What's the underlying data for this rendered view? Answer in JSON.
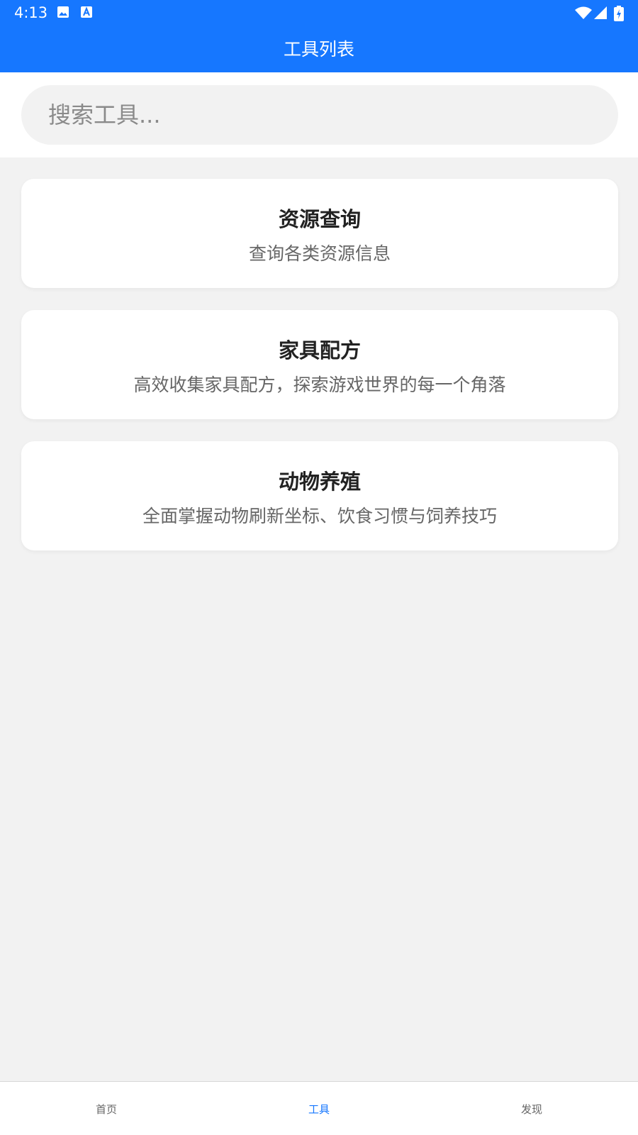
{
  "status_bar": {
    "time": "4:13",
    "icons": [
      "image-icon",
      "a-text-icon",
      "wifi-icon",
      "signal-icon",
      "battery-charging-icon"
    ]
  },
  "header": {
    "title": "工具列表",
    "background_color": "#1677ff"
  },
  "search": {
    "placeholder": "搜索工具...",
    "value": ""
  },
  "tools": [
    {
      "title": "资源查询",
      "description": "查询各类资源信息"
    },
    {
      "title": "家具配方",
      "description": "高效收集家具配方，探索游戏世界的每一个角落"
    },
    {
      "title": "动物养殖",
      "description": "全面掌握动物刷新坐标、饮食习惯与饲养技巧"
    }
  ],
  "bottom_nav": {
    "items": [
      {
        "label": "首页",
        "active": false
      },
      {
        "label": "工具",
        "active": true
      },
      {
        "label": "发现",
        "active": false
      }
    ],
    "active_color": "#1677ff"
  }
}
